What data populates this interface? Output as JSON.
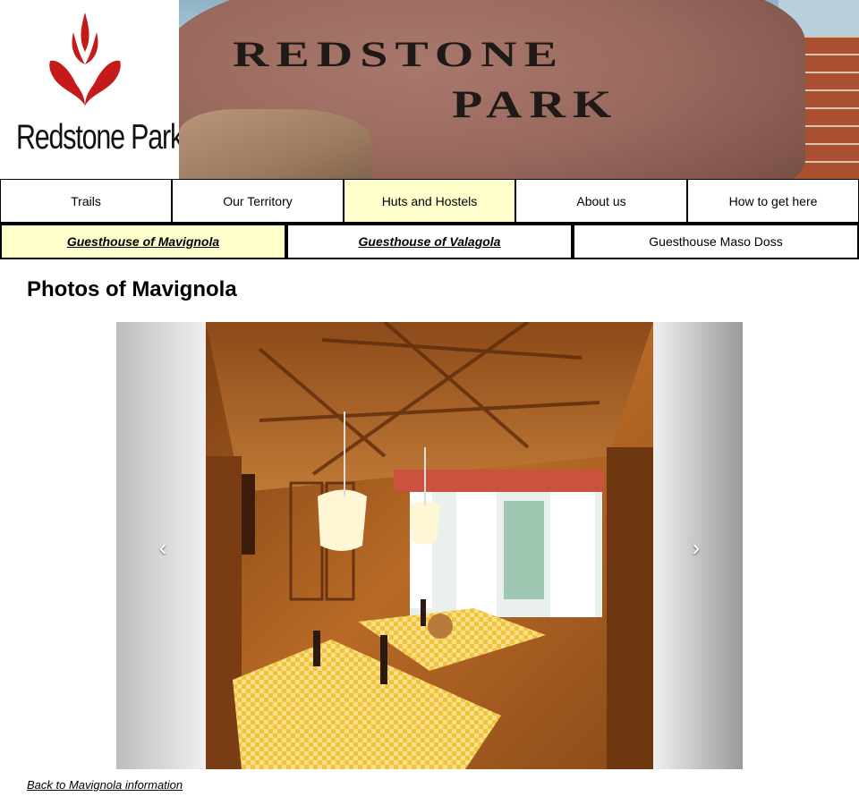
{
  "brand": {
    "logo_text": "Redstone Park",
    "banner_line1": "REDSTONE",
    "banner_line2": "PARK",
    "logo_color": "#c41a1a"
  },
  "nav": {
    "items": [
      {
        "label": "Trails",
        "active": false
      },
      {
        "label": "Our Territory",
        "active": false
      },
      {
        "label": "Huts and Hostels",
        "active": true
      },
      {
        "label": "About us",
        "active": false
      },
      {
        "label": "How to get here",
        "active": false
      }
    ],
    "active_color": "#ffffcc"
  },
  "subnav": {
    "items": [
      {
        "label": "Guesthouse of Mavignola",
        "active": true
      },
      {
        "label": "Guesthouse of Valagola",
        "active": false
      },
      {
        "label": "Guesthouse Maso Doss",
        "active": false
      }
    ]
  },
  "page": {
    "title": "Photos of Mavignola",
    "back_link": "Back to Mavignola information"
  },
  "carousel": {
    "prev_icon": "chevron-left-icon",
    "next_icon": "chevron-right-icon",
    "prev_glyph": "‹",
    "next_glyph": "›"
  }
}
